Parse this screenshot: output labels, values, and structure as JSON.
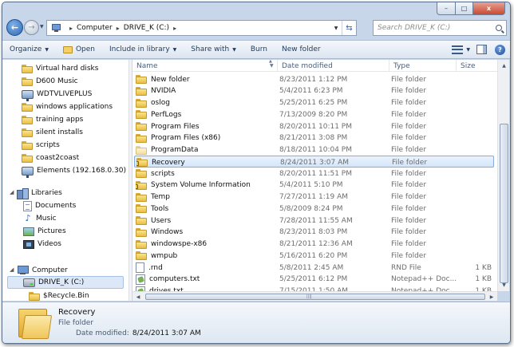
{
  "address": {
    "segments": [
      "Computer",
      "DRIVE_K (C:)"
    ]
  },
  "search": {
    "placeholder": "Search DRIVE_K (C:)"
  },
  "window_buttons": {
    "minimize": "–",
    "maximize": "□",
    "close": "x"
  },
  "toolbar": {
    "organize": "Organize",
    "open": "Open",
    "include_in_library": "Include in library",
    "share_with": "Share with",
    "burn": "Burn",
    "new_folder": "New folder"
  },
  "nav": {
    "folders": [
      "Virtual hard disks",
      "D600 Music",
      "WDTVLIVEPLUS",
      "windows applications",
      "training apps",
      "silent installs",
      "scripts",
      "coast2coast",
      "Elements (192.168.0.30)"
    ],
    "libraries": {
      "label": "Libraries",
      "items": [
        "Documents",
        "Music",
        "Pictures",
        "Videos"
      ]
    },
    "computer": {
      "label": "Computer",
      "items": [
        "DRIVE_K (C:)",
        "$Recycle.Bin"
      ]
    }
  },
  "columns": {
    "name": "Name",
    "date": "Date modified",
    "type": "Type",
    "size": "Size"
  },
  "files": [
    {
      "name": "New folder",
      "date": "8/23/2011 1:12 PM",
      "type": "File folder",
      "size": "",
      "icon": "folder-icon"
    },
    {
      "name": "NVIDIA",
      "date": "5/4/2011 6:23 PM",
      "type": "File folder",
      "size": "",
      "icon": "folder-icon"
    },
    {
      "name": "oslog",
      "date": "5/25/2011 6:25 PM",
      "type": "File folder",
      "size": "",
      "icon": "folder-icon"
    },
    {
      "name": "PerfLogs",
      "date": "7/13/2009 8:20 PM",
      "type": "File folder",
      "size": "",
      "icon": "folder-icon"
    },
    {
      "name": "Program Files",
      "date": "8/20/2011 10:11 PM",
      "type": "File folder",
      "size": "",
      "icon": "folder-icon"
    },
    {
      "name": "Program Files (x86)",
      "date": "8/21/2011 3:08 PM",
      "type": "File folder",
      "size": "",
      "icon": "folder-icon"
    },
    {
      "name": "ProgramData",
      "date": "8/18/2011 10:04 PM",
      "type": "File folder",
      "size": "",
      "icon": "faded-folder-icon"
    },
    {
      "name": "Recovery",
      "date": "8/24/2011 3:07 AM",
      "type": "File folder",
      "size": "",
      "icon": "locked-folder-icon"
    },
    {
      "name": "scripts",
      "date": "8/20/2011 11:51 PM",
      "type": "File folder",
      "size": "",
      "icon": "folder-icon"
    },
    {
      "name": "System Volume Information",
      "date": "5/4/2011 5:10 PM",
      "type": "File folder",
      "size": "",
      "icon": "locked-folder-icon"
    },
    {
      "name": "Temp",
      "date": "7/27/2011 1:19 AM",
      "type": "File folder",
      "size": "",
      "icon": "folder-icon"
    },
    {
      "name": "Tools",
      "date": "5/8/2009 8:24 PM",
      "type": "File folder",
      "size": "",
      "icon": "folder-icon"
    },
    {
      "name": "Users",
      "date": "7/28/2011 11:55 AM",
      "type": "File folder",
      "size": "",
      "icon": "folder-icon"
    },
    {
      "name": "Windows",
      "date": "8/23/2011 8:03 PM",
      "type": "File folder",
      "size": "",
      "icon": "folder-icon"
    },
    {
      "name": "windowspe-x86",
      "date": "8/21/2011 12:36 AM",
      "type": "File folder",
      "size": "",
      "icon": "folder-icon"
    },
    {
      "name": "wmpub",
      "date": "5/16/2011 6:20 PM",
      "type": "File folder",
      "size": "",
      "icon": "folder-icon"
    },
    {
      "name": ".rnd",
      "date": "5/8/2011 2:45 AM",
      "type": "RND File",
      "size": "1 KB",
      "icon": "file-icon"
    },
    {
      "name": "computers.txt",
      "date": "5/25/2011 6:12 PM",
      "type": "Notepad++ Doc...",
      "size": "1 KB",
      "icon": "notepad-file-icon"
    },
    {
      "name": "drives.txt",
      "date": "7/15/2011 1:50 AM",
      "type": "Notepad++ Doc...",
      "size": "1 KB",
      "icon": "notepad-file-icon"
    }
  ],
  "selected_file": "Recovery",
  "details": {
    "name": "Recovery",
    "type": "File folder",
    "modified_label": "Date modified:",
    "modified_value": "8/24/2011 3:07 AM"
  }
}
